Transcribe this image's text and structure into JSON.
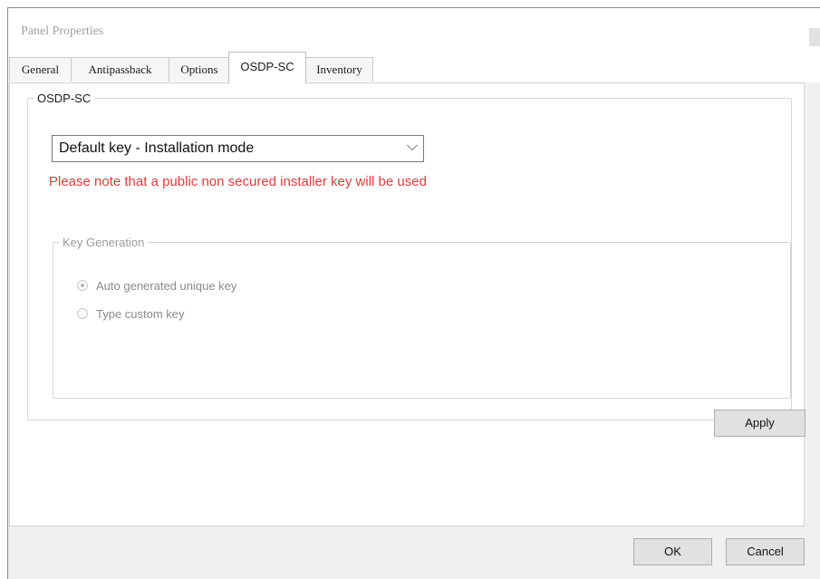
{
  "window": {
    "title": "Panel Properties"
  },
  "tabs": [
    {
      "label": "General"
    },
    {
      "label": "Antipassback"
    },
    {
      "label": "Options"
    },
    {
      "label": "OSDP-SC"
    },
    {
      "label": "Inventory"
    }
  ],
  "active_tab": "OSDP-SC",
  "osdp": {
    "group_label": "OSDP-SC",
    "key_mode": {
      "selected": "Default key - Installation mode",
      "arrow_icon": "chevron-down-icon"
    },
    "warning": "Please note that a public non secured installer key will be used",
    "warning_color": "#e03c3c",
    "key_generation": {
      "group_label": "Key Generation",
      "options": [
        {
          "label": "Auto generated unique key",
          "checked": true,
          "enabled": false
        },
        {
          "label": "Type custom key",
          "checked": false,
          "enabled": false
        }
      ]
    },
    "apply_label": "Apply"
  },
  "footer": {
    "ok_label": "OK",
    "cancel_label": "Cancel"
  }
}
